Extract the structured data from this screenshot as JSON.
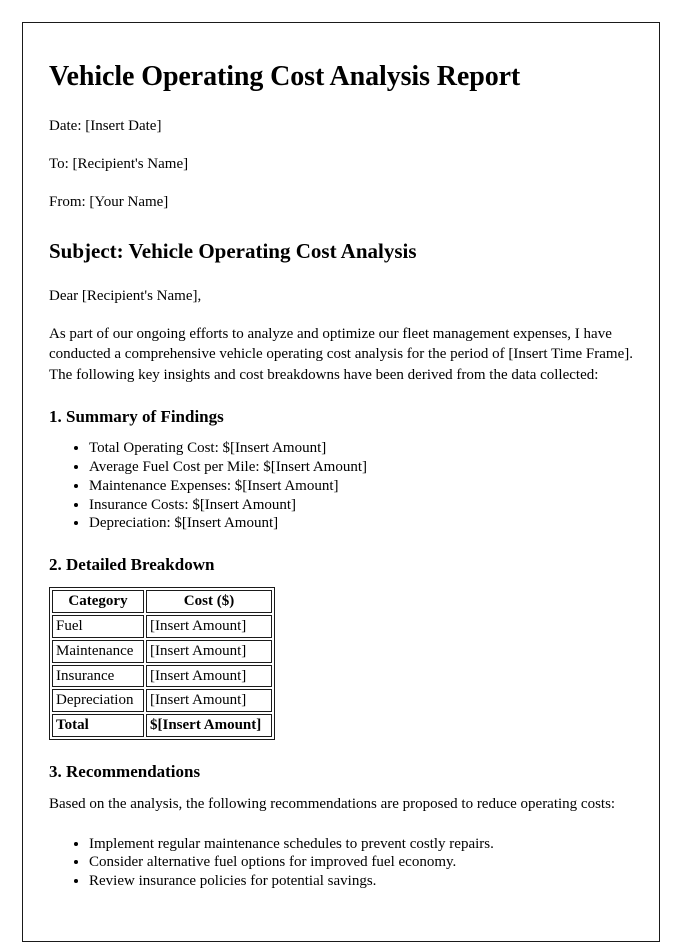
{
  "document": {
    "title": "Vehicle Operating Cost Analysis Report",
    "meta": {
      "date": "Date: [Insert Date]",
      "to": "To: [Recipient's Name]",
      "from": "From: [Your Name]"
    },
    "subject_heading": "Subject: Vehicle Operating Cost Analysis",
    "salutation": "Dear [Recipient's Name],",
    "intro_paragraph": "As part of our ongoing efforts to analyze and optimize our fleet management expenses, I have conducted a comprehensive vehicle operating cost analysis for the period of [Insert Time Frame]. The following key insights and cost breakdowns have been derived from the data collected:",
    "sections": {
      "summary": {
        "heading": "1. Summary of Findings",
        "items": [
          "Total Operating Cost: $[Insert Amount]",
          "Average Fuel Cost per Mile: $[Insert Amount]",
          "Maintenance Expenses: $[Insert Amount]",
          "Insurance Costs: $[Insert Amount]",
          "Depreciation: $[Insert Amount]"
        ]
      },
      "breakdown": {
        "heading": "2. Detailed Breakdown",
        "table": {
          "columns": [
            "Category",
            "Cost ($)"
          ],
          "rows": [
            [
              "Fuel",
              "[Insert Amount]"
            ],
            [
              "Maintenance",
              "[Insert Amount]"
            ],
            [
              "Insurance",
              "[Insert Amount]"
            ],
            [
              "Depreciation",
              "[Insert Amount]"
            ]
          ],
          "total_row": [
            "Total",
            "$[Insert Amount]"
          ]
        }
      },
      "recommendations": {
        "heading": "3. Recommendations",
        "intro": "Based on the analysis, the following recommendations are proposed to reduce operating costs:",
        "items": [
          "Implement regular maintenance schedules to prevent costly repairs.",
          "Consider alternative fuel options for improved fuel economy.",
          "Review insurance policies for potential savings."
        ]
      }
    }
  }
}
